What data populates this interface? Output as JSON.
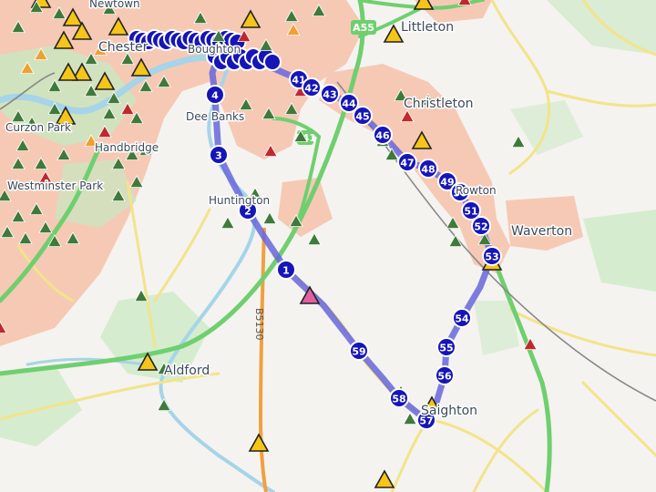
{
  "map": {
    "places": [
      {
        "name": "Littleton"
      },
      {
        "name": "Christleton"
      },
      {
        "name": "Dee Banks"
      },
      {
        "name": "Huntington"
      },
      {
        "name": "Waverton"
      },
      {
        "name": "Saighton"
      },
      {
        "name": "Aldford"
      },
      {
        "name": "Boughton"
      },
      {
        "name": "Chester"
      },
      {
        "name": "Newtown"
      },
      {
        "name": "Westminster Park"
      },
      {
        "name": "Curzon Park"
      },
      {
        "name": "Handbridge"
      },
      {
        "name": "Rowton"
      }
    ],
    "roads": {
      "a55": "A55",
      "a41": "A41",
      "b5130": "B5130"
    },
    "colors": {
      "route": "#6666dd",
      "waypoint": "#1515b8",
      "urban": "#f6c9b5",
      "wood": "#c8e8c0",
      "primary_road": "#6fcf6f",
      "b_road": "#f0a040",
      "minor_road": "#f2e48a",
      "river": "#a6d4e8",
      "railway": "#888888",
      "summit_green": "#3f7a3a",
      "summit_red": "#c0282d",
      "summit_yellow": "#f5c518"
    },
    "route_waypoints": [
      "1",
      "2",
      "3",
      "4",
      "41",
      "42",
      "43",
      "44",
      "45",
      "46",
      "47",
      "48",
      "49",
      "50",
      "51",
      "52",
      "53",
      "54",
      "55",
      "56",
      "57",
      "58",
      "59"
    ]
  }
}
